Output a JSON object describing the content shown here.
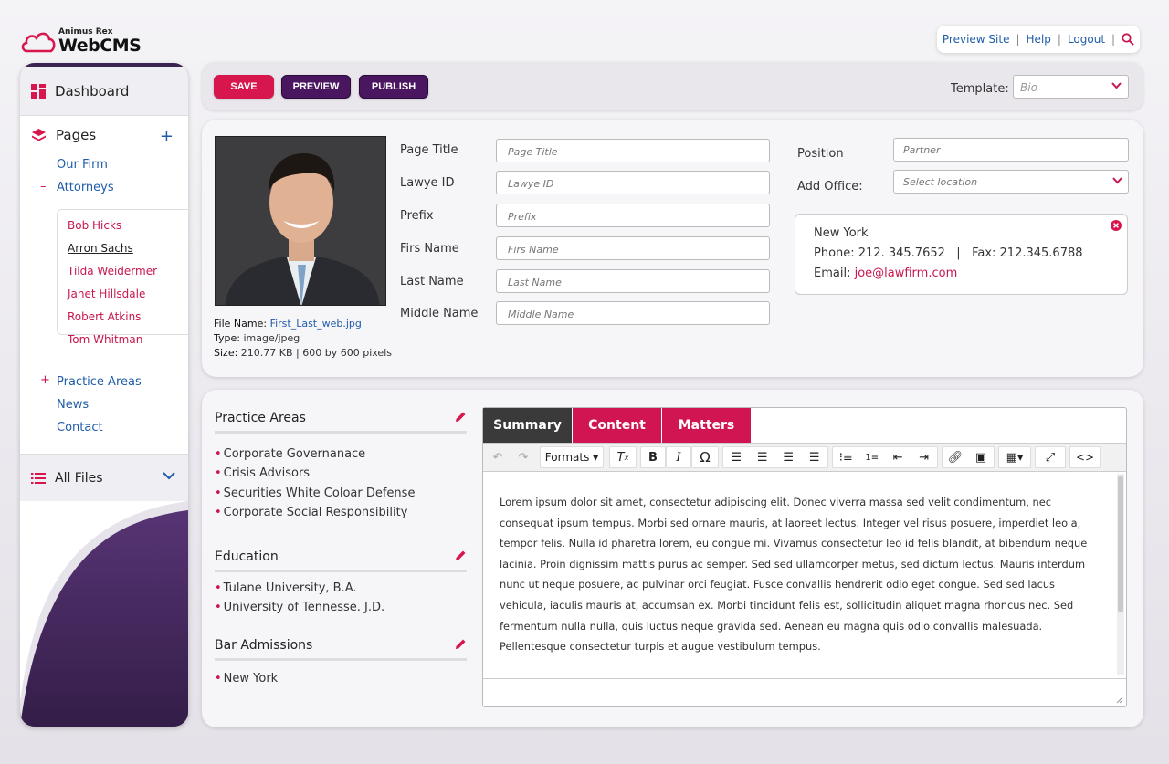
{
  "app": {
    "brand_small": "Animus Rex",
    "brand_big": "WebCMS",
    "accent": "#d8164e",
    "purple": "#4a1660"
  },
  "toplinks": {
    "preview_site": "Preview Site",
    "help": "Help",
    "logout": "Logout"
  },
  "sidebar": {
    "dashboard": "Dashboard",
    "pages": "Pages",
    "our_firm": "Our Firm",
    "attorneys": "Attorneys",
    "attorneys_list": [
      "Bob Hicks",
      "Arron Sachs",
      "Tilda Weidermer",
      "Janet Hillsdale",
      "Robert Atkins",
      "Tom Whitman"
    ],
    "practice_areas": "Practice Areas",
    "news": "News",
    "contact": "Contact",
    "all_files": "All Files"
  },
  "actions": {
    "save": "SAVE",
    "preview": "PREVIEW",
    "publish": "PUBLISH",
    "template_label": "Template:",
    "template_value": "Bio"
  },
  "file": {
    "name_label": "File Name:",
    "name_value": "First_Last_web.jpg",
    "type_label": "Type:",
    "type_value": "image/jpeg",
    "size_label": "Size:",
    "size_value": "210.77 KB  |  600 by 600 pixels"
  },
  "form": {
    "page_title": {
      "label": "Page Title",
      "placeholder": "Page Title"
    },
    "lawyer_id": {
      "label": "Lawye ID",
      "placeholder": "Lawye ID"
    },
    "prefix": {
      "label": "Prefix",
      "placeholder": "Prefix"
    },
    "first_name": {
      "label": "Firs Name",
      "placeholder": "Firs Name"
    },
    "last_name": {
      "label": "Last Name",
      "placeholder": "Last Name"
    },
    "middle_name": {
      "label": "Middle Name",
      "placeholder": "Middle Name"
    },
    "position": {
      "label": "Position",
      "placeholder": "Partner"
    },
    "add_office": {
      "label": "Add Office:",
      "placeholder": "Select location"
    }
  },
  "office": {
    "city": "New York",
    "phone": "Phone: 212. 345.7652",
    "fax": "Fax: 212.345.6788",
    "email_label": "Email:",
    "email": "joe@lawfirm.com"
  },
  "practice_areas": {
    "title": "Practice Areas",
    "items": [
      "Corporate Governanace",
      "Crisis Advisors",
      "Securities White Coloar Defense",
      "Corporate Social Responsibility"
    ]
  },
  "education": {
    "title": "Education",
    "items": [
      "Tulane University, B.A.",
      "University of Tennesse. J.D."
    ]
  },
  "bar_admissions": {
    "title": "Bar Admissions",
    "items": [
      "New York"
    ]
  },
  "editor": {
    "tabs": [
      "Summary",
      "Content",
      "Matters"
    ],
    "formats": "Formats",
    "body": "Lorem ipsum dolor sit amet, consectetur adipiscing elit. Donec viverra massa sed velit condimentum, nec consequat ipsum tempus. Morbi sed ornare mauris, at laoreet lectus. Integer vel risus posuere, imperdiet leo a, tempor felis. Nulla id pharetra lorem, eu congue mi. Vivamus consectetur leo id felis blandit, at bibendum neque lacinia. Proin dignissim mattis purus ac semper. Sed sed ullamcorper metus, sed dictum lectus. Mauris interdum nunc ut neque posuere, ac pulvinar orci feugiat. Fusce convallis hendrerit odio eget congue. Sed sed lacus vehicula, iaculis mauris at, accumsan ex. Morbi tincidunt felis est, sollicitudin aliquet magna rhoncus nec. Sed fermentum nulla nulla, quis luctus neque gravida sed. Aenean eu magna quis odio convallis malesuada. Pellentesque consectetur turpis et augue vestibulum tempus."
  }
}
